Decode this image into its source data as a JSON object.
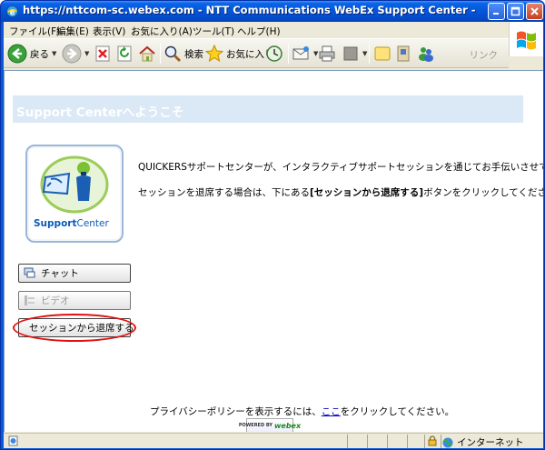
{
  "window": {
    "title": "https://nttcom-sc.webex.com - NTT Communications WebEx Support Center - Microsoft Internet Expl..."
  },
  "menubar": {
    "items": [
      "ファイル(F)",
      "編集(E)",
      "表示(V)",
      "お気に入り(A)",
      "ツール(T)",
      "ヘルプ(H)"
    ]
  },
  "toolbar": {
    "back_label": "戻る",
    "search_label": "検索",
    "favorites_label": "お気に入り",
    "links_label": "リンク"
  },
  "page": {
    "banner_title": "Support Centerへようこそ",
    "logo": {
      "brand_bold": "Support",
      "brand_light": "Center"
    },
    "intro_line1": "QUICKERSサポートセンターが、インタラクティブサポートセッションを通じてお手伝いさせていただきます。",
    "intro_line2_pre": "セッションを退席する場合は、下にある",
    "intro_line2_bold": "[セッションから退席する]",
    "intro_line2_post": "ボタンをクリックしてください。",
    "buttons": {
      "chat": "チャット",
      "video": "ビデオ",
      "leave": "セッションから退席する"
    },
    "privacy_pre": "プライバシーポリシーを表示するには、",
    "privacy_link": "ここ",
    "privacy_post": "をクリックしてください。",
    "powered_text": "POWERED BY",
    "powered_brand": "webex"
  },
  "statusbar": {
    "zone": "インターネット"
  },
  "colors": {
    "highlight": "#e01010",
    "banner": "#dbe8f5",
    "link": "#0000cc"
  }
}
